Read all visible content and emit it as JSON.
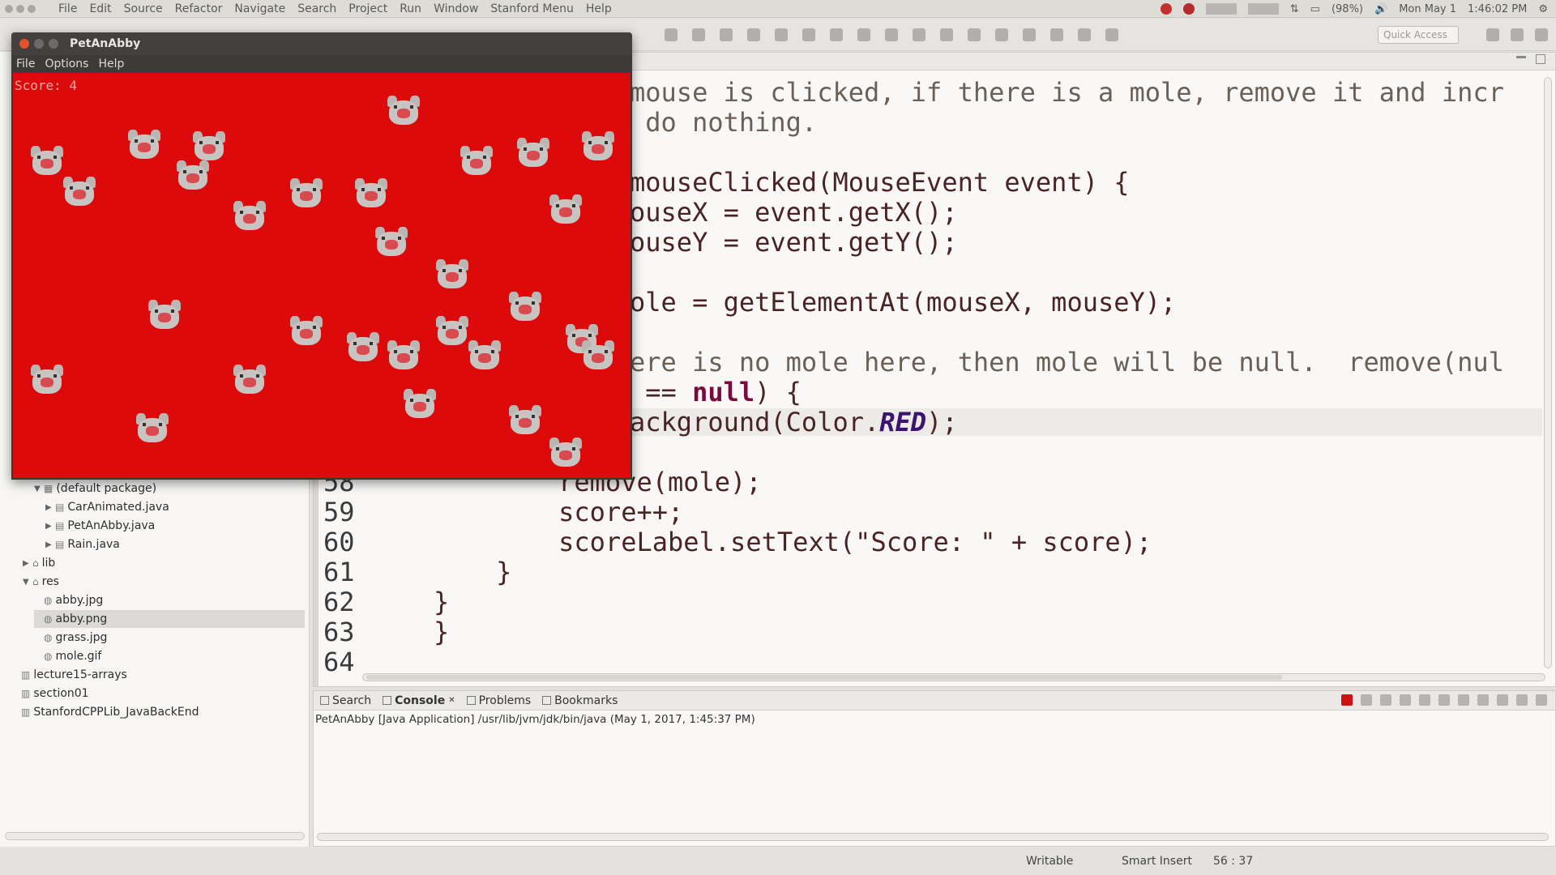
{
  "topbar": {
    "menu": [
      "File",
      "Edit",
      "Source",
      "Refactor",
      "Navigate",
      "Search",
      "Project",
      "Run",
      "Window",
      "Stanford Menu",
      "Help"
    ],
    "battery": "(98%)",
    "date": "Mon May 1",
    "time": "1:46:02 PM"
  },
  "toolbar": {
    "quick_access_placeholder": "Quick Access"
  },
  "explorer": {
    "items": [
      {
        "label": "(default package)",
        "indent": 2,
        "arrow": "▼",
        "icon": "package-icon"
      },
      {
        "label": "CarAnimated.java",
        "indent": 3,
        "arrow": "▶",
        "icon": "java-file-icon"
      },
      {
        "label": "PetAnAbby.java",
        "indent": 3,
        "arrow": "▶",
        "icon": "java-file-icon"
      },
      {
        "label": "Rain.java",
        "indent": 3,
        "arrow": "▶",
        "icon": "java-file-icon"
      },
      {
        "label": "lib",
        "indent": 1,
        "arrow": "▶",
        "icon": "folder-icon"
      },
      {
        "label": "res",
        "indent": 1,
        "arrow": "▼",
        "icon": "folder-icon"
      },
      {
        "label": "abby.jpg",
        "indent": 2,
        "arrow": "",
        "icon": "image-file-icon"
      },
      {
        "label": "abby.png",
        "indent": 2,
        "arrow": "",
        "icon": "image-file-icon",
        "selected": true
      },
      {
        "label": "grass.jpg",
        "indent": 2,
        "arrow": "",
        "icon": "image-file-icon"
      },
      {
        "label": "mole.gif",
        "indent": 2,
        "arrow": "",
        "icon": "image-file-icon"
      },
      {
        "label": "lecture15-arrays",
        "indent": 0,
        "arrow": "",
        "icon": "project-icon"
      },
      {
        "label": "section01",
        "indent": 0,
        "arrow": "",
        "icon": "project-icon"
      },
      {
        "label": "StanfordCPPLib_JavaBackEnd",
        "indent": 0,
        "arrow": "",
        "icon": "project-icon"
      }
    ]
  },
  "editor": {
    "lines": [
      {
        "num": "",
        "segments": [
          {
            "t": "mouse is clicked, if there is a mole, remove it and incr",
            "c": "cmt"
          }
        ]
      },
      {
        "num": "",
        "segments": [
          {
            "t": " do nothing.",
            "c": "cmt"
          }
        ]
      },
      {
        "num": "",
        "segments": [
          {
            "t": "",
            "c": ""
          }
        ]
      },
      {
        "num": "",
        "segments": [
          {
            "t": "mouseClicked(MouseEvent event) {",
            "c": ""
          }
        ]
      },
      {
        "num": "",
        "segments": [
          {
            "t": "ouseX = event.getX();",
            "c": ""
          }
        ]
      },
      {
        "num": "",
        "segments": [
          {
            "t": "ouseY = event.getY();",
            "c": ""
          }
        ]
      },
      {
        "num": "",
        "segments": [
          {
            "t": "",
            "c": ""
          }
        ]
      },
      {
        "num": "",
        "segments": [
          {
            "t": "ole = getElementAt(mouseX, mouseY);",
            "c": ""
          }
        ]
      },
      {
        "num": "",
        "segments": [
          {
            "t": "",
            "c": ""
          }
        ]
      },
      {
        "num": "",
        "segments": [
          {
            "t": "ere is no mole here, then mole will be null.  remove(nul",
            "c": "cmt"
          }
        ]
      },
      {
        "num": "",
        "segments": [
          {
            "t": " == ",
            "c": ""
          },
          {
            "t": "null",
            "c": "kw"
          },
          {
            "t": ") {",
            "c": ""
          }
        ]
      },
      {
        "num": "",
        "segments": [
          {
            "t": "ackground(Color.",
            "c": ""
          },
          {
            "t": "RED",
            "c": "it"
          },
          {
            "t": ");",
            "c": ""
          }
        ],
        "highlight": true
      },
      {
        "num": "",
        "segments": [
          {
            "t": "",
            "c": ""
          }
        ]
      },
      {
        "num": "58",
        "segments": [
          {
            "t": "        remove(mole);",
            "c": ""
          }
        ]
      },
      {
        "num": "59",
        "segments": [
          {
            "t": "        score++;",
            "c": ""
          }
        ]
      },
      {
        "num": "60",
        "segments": [
          {
            "t": "        scoreLabel.setText(\"Score: \" + score);",
            "c": ""
          }
        ]
      },
      {
        "num": "61",
        "segments": [
          {
            "t": "    }",
            "c": ""
          }
        ]
      },
      {
        "num": "62",
        "segments": [
          {
            "t": "}",
            "c": ""
          }
        ]
      },
      {
        "num": "63",
        "segments": [
          {
            "t": "}",
            "c": ""
          }
        ]
      },
      {
        "num": "64",
        "segments": [
          {
            "t": "",
            "c": ""
          }
        ]
      }
    ]
  },
  "console": {
    "tabs": [
      "Search",
      "Console",
      "Problems",
      "Bookmarks"
    ],
    "active_tab": "Console",
    "title": "PetAnAbby [Java Application] /usr/lib/jvm/jdk/bin/java (May 1, 2017, 1:45:37 PM)"
  },
  "statusbar": {
    "writable": "Writable",
    "insert_mode": "Smart Insert",
    "position": "56 : 37"
  },
  "app": {
    "title": "PetAnAbby",
    "menu": [
      "File",
      "Options",
      "Help"
    ],
    "score_label": "Score: 4",
    "canvas_color": "#dc0a0a"
  }
}
